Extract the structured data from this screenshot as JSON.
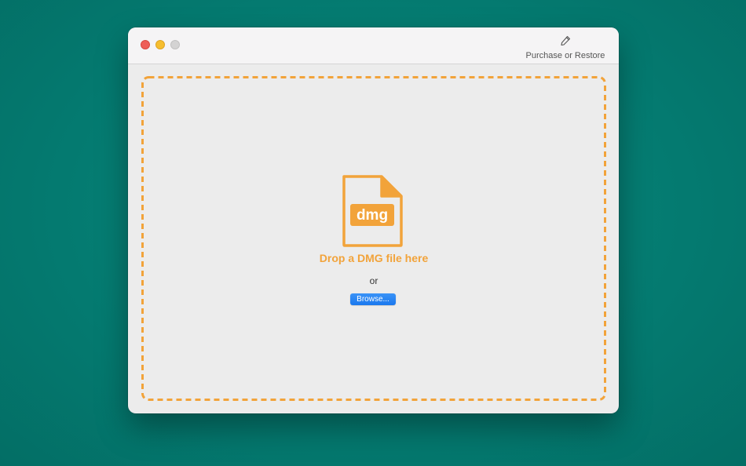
{
  "window": {
    "controls": {
      "close": "close",
      "minimize": "minimize",
      "zoom": "zoom"
    }
  },
  "toolbar": {
    "purchase_icon": "pencil-icon",
    "purchase_label": "Purchase or Restore"
  },
  "drop_zone": {
    "file_icon": "dmg-file-icon",
    "file_icon_text": "dmg",
    "title": "Drop a DMG file here",
    "or_text": "or",
    "browse_label": "Browse..."
  },
  "colors": {
    "accent_orange": "#f2a33a",
    "button_blue": "#1a78ee",
    "background_teal": "#047a70"
  }
}
